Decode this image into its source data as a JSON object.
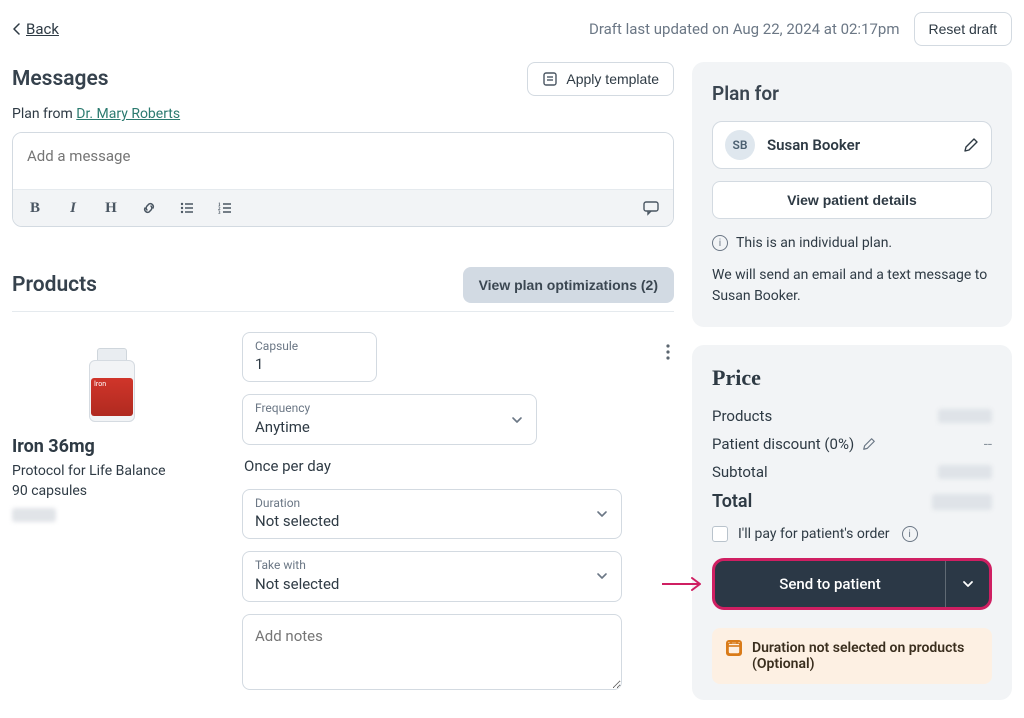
{
  "topbar": {
    "back": "Back",
    "draft_ts": "Draft last updated on Aug 22, 2024 at 02:17pm",
    "reset": "Reset draft"
  },
  "messages": {
    "heading": "Messages",
    "apply_template": "Apply template",
    "plan_from_prefix": "Plan from ",
    "plan_from_name": "Dr. Mary Roberts",
    "placeholder": "Add a message"
  },
  "products_section": {
    "heading": "Products",
    "optimizations": "View plan optimizations (2)"
  },
  "product": {
    "name": "Iron 36mg",
    "brand": "Protocol for Life Balance",
    "size": "90 capsules",
    "bottle_text": "Iron",
    "fields": {
      "capsule_label": "Capsule",
      "capsule_value": "1",
      "frequency_label": "Frequency",
      "frequency_value": "Anytime",
      "once_per_day": "Once per day",
      "duration_label": "Duration",
      "duration_value": "Not selected",
      "take_with_label": "Take with",
      "take_with_value": "Not selected",
      "notes_placeholder": "Add notes"
    }
  },
  "plan_panel": {
    "heading": "Plan for",
    "patient_initials": "SB",
    "patient_name": "Susan Booker",
    "view_details": "View patient details",
    "individual_note": "This is an individual plan.",
    "send_note": "We will send an email and a text message to Susan Booker."
  },
  "price_panel": {
    "heading": "Price",
    "rows": {
      "products": "Products",
      "discount": "Patient discount (0%)",
      "discount_value": "--",
      "subtotal": "Subtotal",
      "total": "Total"
    },
    "pay_check": "I'll pay for patient's order",
    "send_btn": "Send to patient",
    "warning": "Duration not selected on products (Optional)"
  }
}
